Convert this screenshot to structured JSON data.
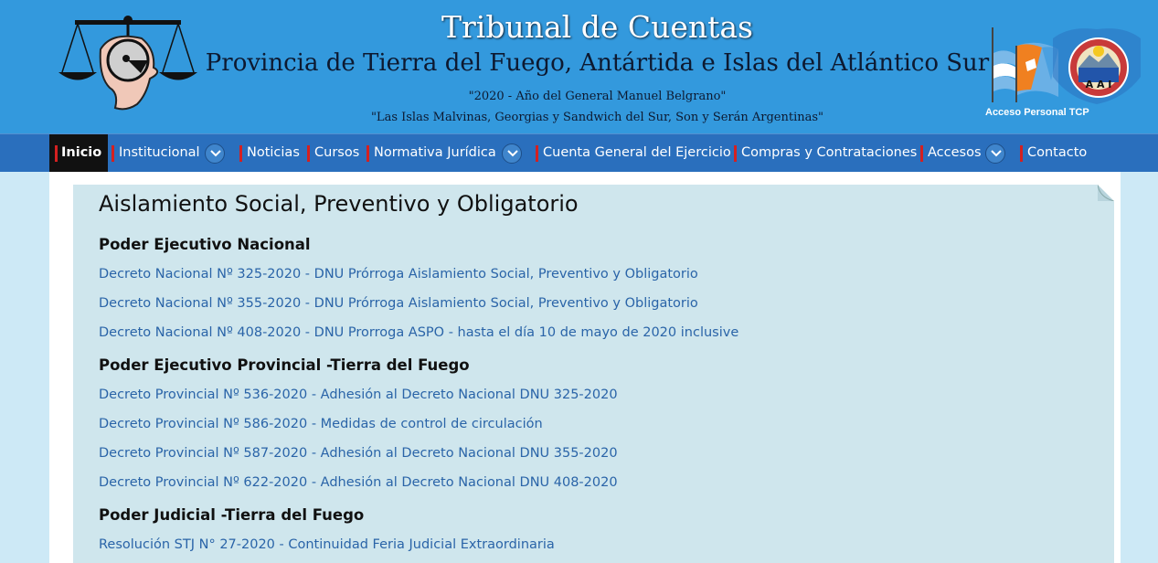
{
  "header": {
    "title": "Tribunal de Cuentas",
    "subtitle": "Provincia de Tierra del Fuego, Antártida e Islas del Atlántico Sur",
    "motto_1": "\"2020 - Año del General Manuel Belgrano\"",
    "motto_2": "\"Las Islas Malvinas, Georgias y Sandwich del Sur, Son y Serán Argentinas\"",
    "acceso_label": "Acceso Personal TCP"
  },
  "nav": {
    "items": [
      {
        "label": "Inicio",
        "active": true,
        "dropdown": false
      },
      {
        "label": "Institucional",
        "dropdown": true
      },
      {
        "label": "Noticias",
        "dropdown": false
      },
      {
        "label": "Cursos",
        "dropdown": false
      },
      {
        "label": "Normativa Jurídica",
        "dropdown": true
      },
      {
        "label": "Cuenta General del Ejercicio",
        "dropdown": false
      },
      {
        "label": "Compras y Contrataciones",
        "dropdown": false
      },
      {
        "label": "Accesos",
        "dropdown": true
      },
      {
        "label": "Contacto",
        "dropdown": false
      }
    ]
  },
  "content": {
    "page_title": "Aislamiento Social, Preventivo y Obligatorio",
    "sections": [
      {
        "heading": "Poder Ejecutivo Nacional",
        "links": [
          "Decreto Nacional Nº 325-2020 - DNU Prórroga Aislamiento Social, Preventivo y Obligatorio",
          "Decreto Nacional Nº 355-2020 - DNU Prórroga Aislamiento Social, Preventivo y Obligatorio",
          "Decreto Nacional Nº 408-2020 - DNU Prorroga ASPO - hasta el día 10 de mayo de 2020 inclusive"
        ]
      },
      {
        "heading": "Poder Ejecutivo Provincial -Tierra del Fuego",
        "links": [
          "Decreto Provincial Nº 536-2020 - Adhesión al Decreto Nacional DNU 325-2020",
          "Decreto Provincial Nº 586-2020 - Medidas de control de circulación",
          "Decreto Provincial Nº 587-2020 - Adhesión al Decreto Nacional DNU 355-2020",
          "Decreto Provincial Nº 622-2020 - Adhesión al Decreto Nacional DNU 408-2020"
        ]
      },
      {
        "heading": "Poder Judicial -Tierra del Fuego",
        "links": [
          "Resolución STJ N° 27-2020 - Continuidad Feria Judicial Extraordinaria"
        ]
      }
    ]
  },
  "colors": {
    "header_bg": "#3399dd",
    "nav_bg": "#2a6fbd",
    "nav_separator": "#d42020",
    "link": "#2a64a8",
    "panel_bg": "#cfe6ed",
    "page_bg": "#cde9f6"
  },
  "icons": [
    "scales-of-justice-logo",
    "argentina-flag",
    "tierra-del-fuego-flag",
    "provincial-coat-of-arms",
    "chevron-down-icon"
  ]
}
